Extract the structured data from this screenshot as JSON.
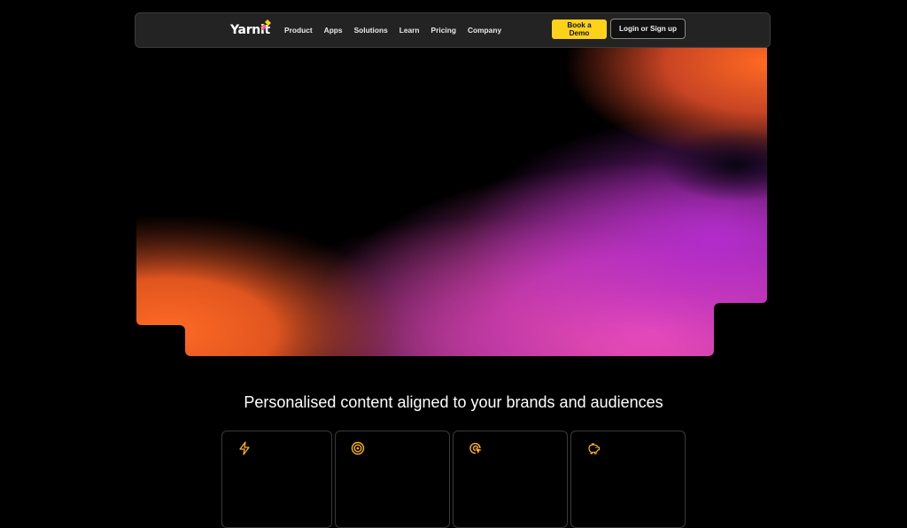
{
  "brand": {
    "name": "Yarnit",
    "accent": "#ffd21a"
  },
  "nav": {
    "links": [
      "Product",
      "Apps",
      "Solutions",
      "Learn",
      "Pricing",
      "Company"
    ],
    "demo_label": "Book a Demo",
    "login_label": "Login or Sign up"
  },
  "hero": {
    "gradient_colors": [
      "#ff6b2b",
      "#e94fb4",
      "#b02fd6",
      "#000000"
    ]
  },
  "features": {
    "title": "Personalised content aligned to your brands and audiences",
    "cards": [
      {
        "icon": "lightning-icon"
      },
      {
        "icon": "target-icon"
      },
      {
        "icon": "cursor-click-icon"
      },
      {
        "icon": "piggy-bank-icon"
      }
    ]
  }
}
